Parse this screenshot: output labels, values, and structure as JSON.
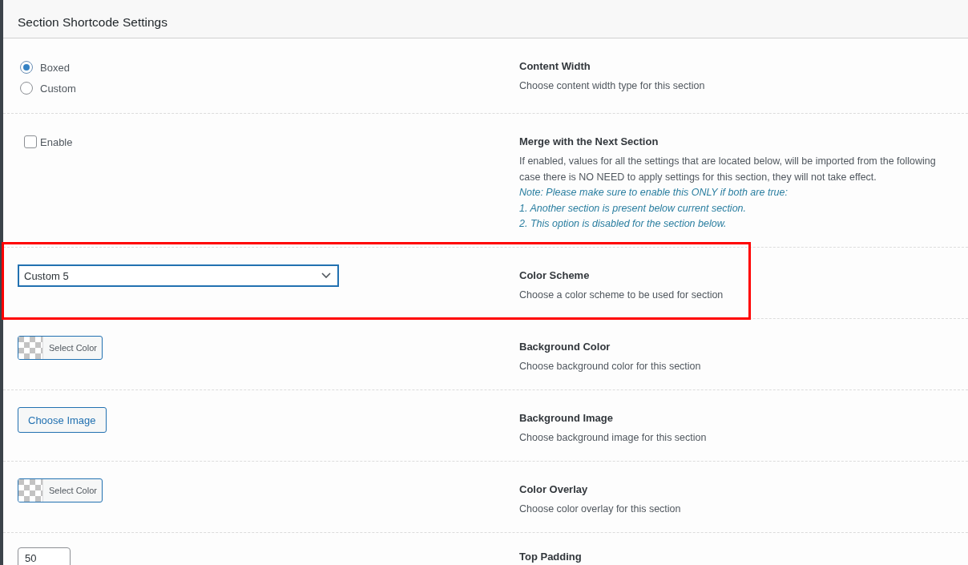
{
  "panel": {
    "title": "Section Shortcode Settings"
  },
  "rows": [
    {
      "kind": "radio",
      "highlighted": false,
      "options": [
        {
          "label": "Boxed",
          "selected": true
        },
        {
          "label": "Custom",
          "selected": false
        }
      ],
      "title": "Content Width",
      "description": [
        "Choose content width type for this section"
      ]
    },
    {
      "kind": "checkbox",
      "highlighted": false,
      "checkbox": {
        "label": "Enable",
        "checked": false
      },
      "title": "Merge with the Next Section",
      "description": [
        "If enabled, values for all the settings that are located below, will be imported from the following",
        "case there is NO NEED to apply settings for this section, they will not take effect."
      ],
      "notes": [
        "Note: Please make sure to enable this ONLY if both are true:",
        "1. Another section is present below current section.",
        "2. This option is disabled for the section below."
      ]
    },
    {
      "kind": "select",
      "highlighted": true,
      "value": "Custom 5",
      "title": "Color Scheme",
      "description": [
        "Choose a color scheme to be used for section"
      ]
    },
    {
      "kind": "color",
      "highlighted": false,
      "button": "Select Color",
      "title": "Background Color",
      "description": [
        "Choose background color for this section"
      ]
    },
    {
      "kind": "image",
      "highlighted": false,
      "button": "Choose Image",
      "title": "Background Image",
      "description": [
        "Choose background image for this section"
      ]
    },
    {
      "kind": "color",
      "highlighted": false,
      "button": "Select Color",
      "title": "Color Overlay",
      "description": [
        "Choose color overlay for this section"
      ]
    },
    {
      "kind": "number",
      "highlighted": false,
      "value": "50",
      "title": "Top Padding"
    }
  ]
}
